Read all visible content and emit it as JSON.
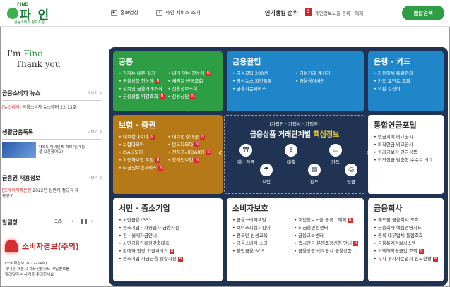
{
  "header": {
    "logo_fine": "FINE",
    "logo_name": "파 인",
    "logo_sub": "금융소비자 정보포털",
    "links": [
      {
        "label": "홍보영상",
        "icon": "video-icon"
      },
      {
        "label": "파인 서비스 소개",
        "icon": "info-icon"
      }
    ],
    "ranking_title": "인기랭킹 순위",
    "ranking_number": "3",
    "ranking_item": "개인정보노출 등록 · 해제",
    "search_label": "통합검색"
  },
  "left": {
    "imfine_l1_pre": "I'm ",
    "imfine_l1_green": "Fine",
    "imfine_l2": "Thank you",
    "news": {
      "title": "금융소비자 뉴스",
      "more": "더보기",
      "tag": "[뉴스레터]",
      "text": " 금융소비자 뉴스레터 22-13호"
    },
    "tips": {
      "title": "생활금융톡톡",
      "more": "더보기",
      "text": "\"ESG 페이먼츠 허브\"뜬개통",
      "text2": "을 오픈했어요!"
    },
    "jobs": {
      "title": "금융권 채용정보",
      "more": "더보기",
      "tag": "[오케이저축은행]",
      "text": "2022년 상반기 정규직 채",
      "text2": "용공고"
    },
    "alarm": {
      "title": "알림창",
      "pager": "3/5",
      "warn": "소비자경보(주의)",
      "desc1": "(소비자경보 2022-04호)",
      "desc2": "휴대폰 개통시 계좌신용카드 비밀번호를",
      "desc3": "알려달라는 사기를 주의하세요"
    }
  },
  "panel": {
    "gongtong": {
      "title": "공통",
      "col1": [
        "잠자는 내돈 찾기",
        "금융상품 한눈에",
        "상속인 금융거래조회",
        "금융상품 약관조회"
      ],
      "col2": [
        "내게 맞는 한눈에",
        "채권자 변동조회",
        "신용정보조회",
        "신용상담"
      ],
      "new1": [
        false,
        true,
        false,
        true
      ],
      "new2": [
        true,
        false,
        false,
        true
      ]
    },
    "ggultip": {
      "title": "금융꿀팁",
      "col1": [
        "금융꿀팁 200선",
        "영상뉴스 파인톡톡",
        "금융자문서비스"
      ],
      "col2": [
        "금융거래 계산기",
        "금융용어사전"
      ]
    },
    "bank": {
      "title": "은행 · 카드",
      "items": [
        "자동이체 통합관리",
        "카드 포인트 조회",
        "외환 길잡이"
      ]
    },
    "insure": {
      "title": "보험 · 증권",
      "col1": [
        "내보험다보여",
        "보험다모아",
        "ISA다모아",
        "자동차보험 포털",
        "e-금인보험서비스"
      ],
      "col2": [
        "내보험 찾아줌",
        "펀드다모아",
        "전자공시(DART)",
        "장애인보험"
      ],
      "new1": [
        true,
        false,
        false,
        true,
        true
      ],
      "new2": [
        true,
        true,
        true,
        true
      ]
    },
    "center": {
      "l1": "(가입전 · 가입시 · 가입후)",
      "l2_main": "금융상품 거래단계별 ",
      "l2_hl": "핵심정보",
      "icons": [
        {
          "label": "예 · 적금",
          "sym": "₩"
        },
        {
          "label": "대출",
          "sym": "$"
        },
        {
          "label": "카드",
          "sym": "▭"
        },
        {
          "label": "보험",
          "sym": "☂"
        },
        {
          "label": "펀드",
          "sym": "▤"
        },
        {
          "label": "연금",
          "sym": "◎"
        }
      ]
    },
    "pension": {
      "title": "통합연금포털",
      "items": [
        "연금지폐 비교공시",
        "퇴직연금 비교공시",
        "원리금보장 연금상품",
        "퇴직연금 맞춤형 수수료 비교"
      ]
    },
    "seomin": {
      "title": "서민 · 중소기업",
      "items": [
        "서민금융1332",
        "중소기업 · 자영업자 금융지원",
        "전 · 월세자금안내",
        "서민금융진흥원맞춤대출",
        "판매자 현장 지원서비스",
        "중소기업 자금금융 중합지원"
      ],
      "new": [
        false,
        false,
        false,
        false,
        true,
        true
      ]
    },
    "consumer": {
      "title": "소비자보호",
      "col1": [
        "금융소비자포털",
        "보이스피싱지킴이",
        "전국민 신용교육",
        "금융소비자 소리",
        "불법금융 SOS"
      ],
      "col2": [
        "개인정보노출 등록 · 해제",
        "e-금융민원센터",
        "금융교육센터",
        "즉시연금 분쟁조정신청 안내",
        "금융상품 비교공시 금융상품"
      ],
      "new2": [
        true,
        false,
        false,
        true,
        false
      ]
    },
    "company": {
      "title": "금융회사",
      "items": [
        "제도권 금융회사 조회",
        "금융회사 핵심경영지표",
        "등록 대부업체 통합조회",
        "금융통계정보시스템",
        "소액해외송금업 조회",
        "유사 투자자문업자 신고현황"
      ],
      "new": [
        false,
        false,
        false,
        false,
        true,
        true
      ]
    }
  },
  "colors": {
    "panel_bg": "#203352",
    "green": "#2e9e45",
    "blue": "#1f86c9",
    "brown": "#b57a17",
    "new_badge": "#d32f2f"
  }
}
